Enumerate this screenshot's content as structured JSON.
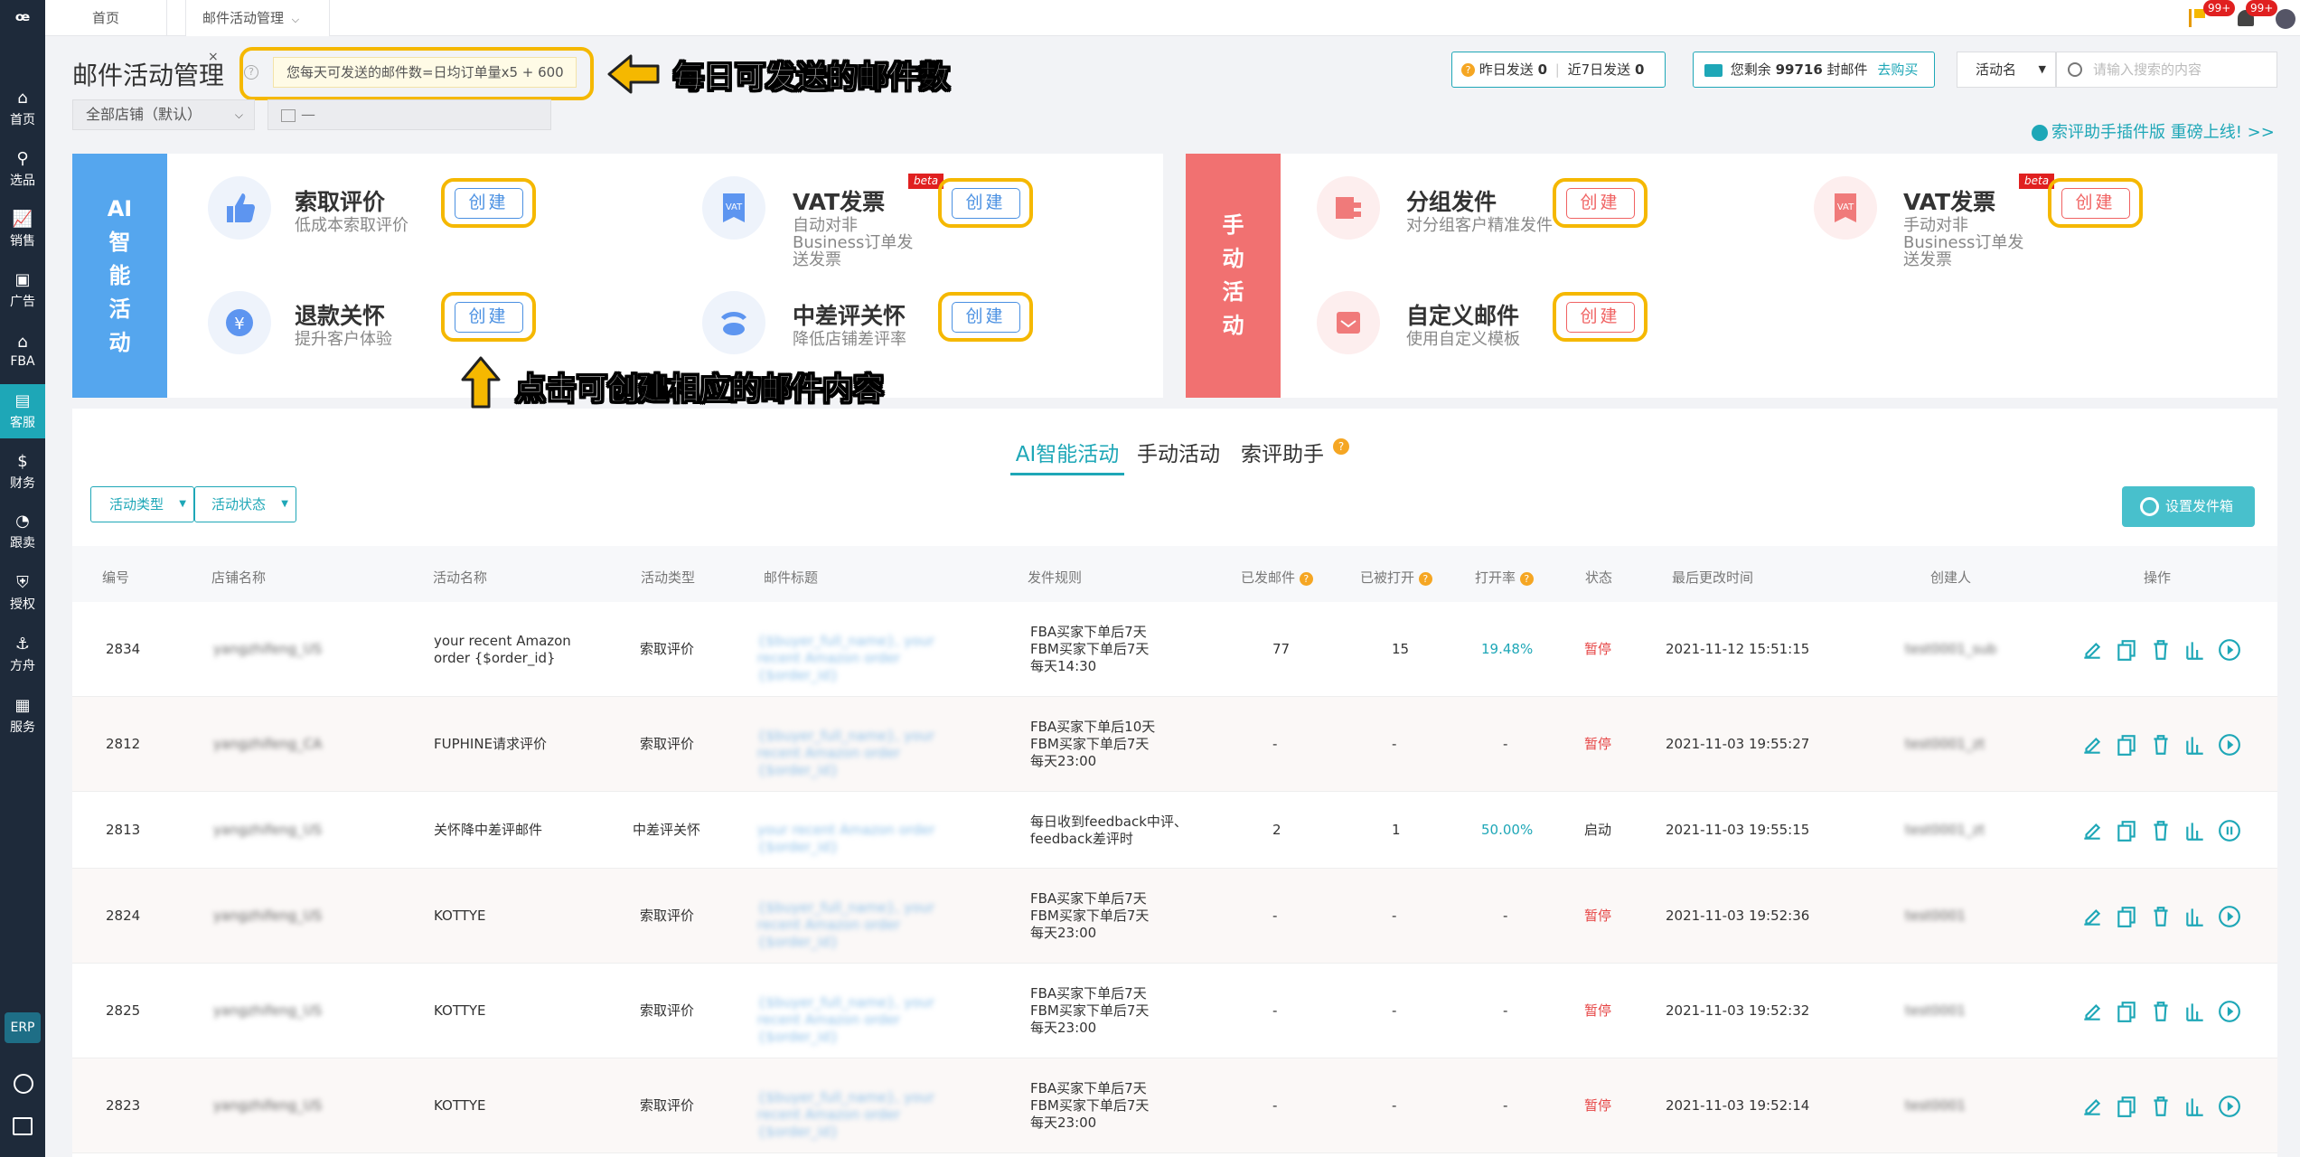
{
  "sidebar": {
    "items": [
      {
        "label": "首页",
        "icon": "home-icon"
      },
      {
        "label": "选品",
        "icon": "search-icon"
      },
      {
        "label": "销售",
        "icon": "chart-icon"
      },
      {
        "label": "广告",
        "icon": "ad-icon"
      },
      {
        "label": "FBA",
        "icon": "warehouse-icon"
      },
      {
        "label": "客服",
        "icon": "service-icon"
      },
      {
        "label": "财务",
        "icon": "finance-icon"
      },
      {
        "label": "跟卖",
        "icon": "pie-icon"
      },
      {
        "label": "授权",
        "icon": "shield-icon"
      },
      {
        "label": "方舟",
        "icon": "ark-icon"
      },
      {
        "label": "服务",
        "icon": "briefcase-icon"
      }
    ],
    "erp": "ERP"
  },
  "tabs": {
    "home": "首页",
    "current": "邮件活动管理"
  },
  "header": {
    "badge1": "99+",
    "badge2": "99+"
  },
  "page": {
    "title": "邮件活动管理",
    "tooltip": "您每天可发送的邮件数=日均订单量x5 + 600",
    "callout_top": "每日可发送的邮件数",
    "callout_bottom": "点击可创建相应的邮件内容",
    "store_select": "全部店铺（默认）",
    "date_placeholder": "—",
    "sent_yesterday_label": "昨日发送",
    "sent_yesterday": "0",
    "sent_7d_label": "近7日发送",
    "sent_7d": "0",
    "remaining_prefix": "您剩余",
    "remaining": "99716",
    "remaining_suffix": "封邮件",
    "buy_link": "去购买",
    "search_type": "活动名",
    "search_placeholder": "请输入搜索的内容",
    "plugin_link": "索评助手插件版 重磅上线! >>"
  },
  "ai_card": {
    "tag": [
      "AI",
      "智",
      "能",
      "活",
      "动"
    ],
    "items": [
      {
        "title": "索取评价",
        "desc": "低成本索取评价",
        "button": "创建"
      },
      {
        "title": "VAT发票",
        "desc": "自动对非Business订单发送发票",
        "button": "创建",
        "beta": "beta"
      },
      {
        "title": "退款关怀",
        "desc": "提升客户体验",
        "button": "创建"
      },
      {
        "title": "中差评关怀",
        "desc": "降低店铺差评率",
        "button": "创建"
      }
    ]
  },
  "manual_card": {
    "tag": [
      "手",
      "动",
      "活",
      "动"
    ],
    "items": [
      {
        "title": "分组发件",
        "desc": "对分组客户精准发件",
        "button": "创建"
      },
      {
        "title": "VAT发票",
        "desc": "手动对非Business订单发送发票",
        "button": "创建",
        "beta": "beta"
      },
      {
        "title": "自定义邮件",
        "desc": "使用自定义模板",
        "button": "创建"
      }
    ]
  },
  "list": {
    "tabs": [
      "AI智能活动",
      "手动活动",
      "索评助手"
    ],
    "filter_type": "活动类型",
    "filter_status": "活动状态",
    "settings_button": "设置发件箱",
    "columns": [
      "编号",
      "店铺名称",
      "活动名称",
      "活动类型",
      "邮件标题",
      "发件规则",
      "已发邮件",
      "已被打开",
      "打开率",
      "状态",
      "最后更改时间",
      "创建人",
      "操作"
    ],
    "rows": [
      {
        "id": "2834",
        "store": "yangzhifeng_US",
        "name": "your recent Amazon order {$order_id}",
        "type": "索取评价",
        "subject": "{$buyer_full_name}, your recent Amazon order {$order_id}",
        "rule": [
          "FBA买家下单后7天",
          "FBM买家下单后7天",
          "每天14:30"
        ],
        "sent": "77",
        "opened": "15",
        "rate": "19.48%",
        "status": "暂停",
        "time": "2021-11-12 15:51:15",
        "creator": "test0001_sub",
        "action": "play"
      },
      {
        "id": "2812",
        "store": "yangzhifeng_CA",
        "name": "FUPHINE请求评价",
        "type": "索取评价",
        "subject": "{$buyer_full_name}, your recent Amazon order {$order_id}",
        "rule": [
          "FBA买家下单后10天",
          "FBM买家下单后7天",
          "每天23:00"
        ],
        "sent": "-",
        "opened": "-",
        "rate": "-",
        "status": "暂停",
        "time": "2021-11-03 19:55:27",
        "creator": "test0001_zt",
        "action": "play"
      },
      {
        "id": "2813",
        "store": "yangzhifeng_US",
        "name": "关怀降中差评邮件",
        "type": "中差评关怀",
        "subject": "your recent Amazon order {$order_id}",
        "rule": [
          "每日收到feedback中评、",
          "feedback差评时"
        ],
        "sent": "2",
        "opened": "1",
        "rate": "50.00%",
        "status": "启动",
        "time": "2021-11-03 19:55:15",
        "creator": "test0001_zt",
        "action": "pause"
      },
      {
        "id": "2824",
        "store": "yangzhifeng_US",
        "name": "KOTTYE",
        "type": "索取评价",
        "subject": "{$buyer_full_name}, your recent Amazon order {$order_id}",
        "rule": [
          "FBA买家下单后7天",
          "FBM买家下单后7天",
          "每天23:00"
        ],
        "sent": "-",
        "opened": "-",
        "rate": "-",
        "status": "暂停",
        "time": "2021-11-03 19:52:36",
        "creator": "test0001",
        "action": "play"
      },
      {
        "id": "2825",
        "store": "yangzhifeng_US",
        "name": "KOTTYE",
        "type": "索取评价",
        "subject": "{$buyer_full_name}, your recent Amazon order {$order_id}",
        "rule": [
          "FBA买家下单后7天",
          "FBM买家下单后7天",
          "每天23:00"
        ],
        "sent": "-",
        "opened": "-",
        "rate": "-",
        "status": "暂停",
        "time": "2021-11-03 19:52:32",
        "creator": "test0001",
        "action": "play"
      },
      {
        "id": "2823",
        "store": "yangzhifeng_US",
        "name": "KOTTYE",
        "type": "索取评价",
        "subject": "{$buyer_full_name}, your recent Amazon order {$order_id}",
        "rule": [
          "FBA买家下单后7天",
          "FBM买家下单后7天",
          "每天23:00"
        ],
        "sent": "-",
        "opened": "-",
        "rate": "-",
        "status": "暂停",
        "time": "2021-11-03 19:52:14",
        "creator": "test0001",
        "action": "play"
      }
    ]
  },
  "colors": {
    "accent": "#1ea7b7",
    "ai_tag": "#4a9ee8",
    "manual_tag": "#f07070",
    "highlight": "#f5b800",
    "pause": "#e64545",
    "link": "#1ea7b7"
  }
}
